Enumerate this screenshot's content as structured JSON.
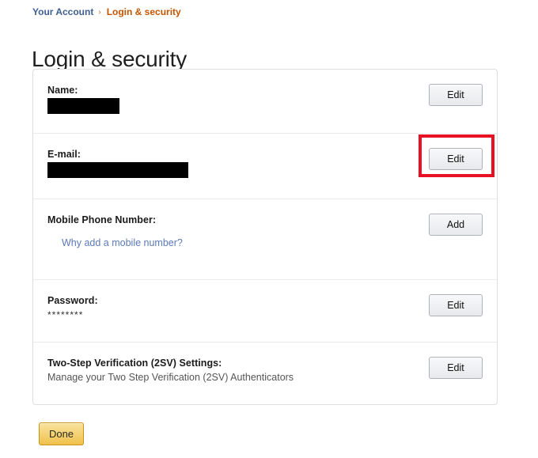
{
  "breadcrumb": {
    "parent_label": "Your Account",
    "separator": "›",
    "current_label": "Login & security"
  },
  "page": {
    "title": "Login & security"
  },
  "sections": [
    {
      "key": "name",
      "label": "Name:",
      "value": "",
      "value_redacted": true,
      "action_label": "Edit",
      "highlighted": false
    },
    {
      "key": "email",
      "label": "E-mail:",
      "value": "",
      "value_redacted": true,
      "action_label": "Edit",
      "highlighted": true
    },
    {
      "key": "mobile",
      "label": "Mobile Phone Number:",
      "link_label": "Why add a mobile number?",
      "action_label": "Add",
      "highlighted": false
    },
    {
      "key": "password",
      "label": "Password:",
      "value": "********",
      "action_label": "Edit",
      "highlighted": false
    },
    {
      "key": "two_step",
      "label": "Two-Step Verification (2SV) Settings:",
      "description": "Manage your Two Step Verification (2SV) Authenticators",
      "action_label": "Edit",
      "highlighted": false
    }
  ],
  "footer": {
    "done_label": "Done"
  },
  "colors": {
    "breadcrumb_link": "#3f5f8f",
    "breadcrumb_current": "#c45500",
    "link_blue": "#5b7ab5",
    "highlight_red": "#e81123",
    "done_button": "#f0c14b",
    "card_border": "#dddddd"
  }
}
